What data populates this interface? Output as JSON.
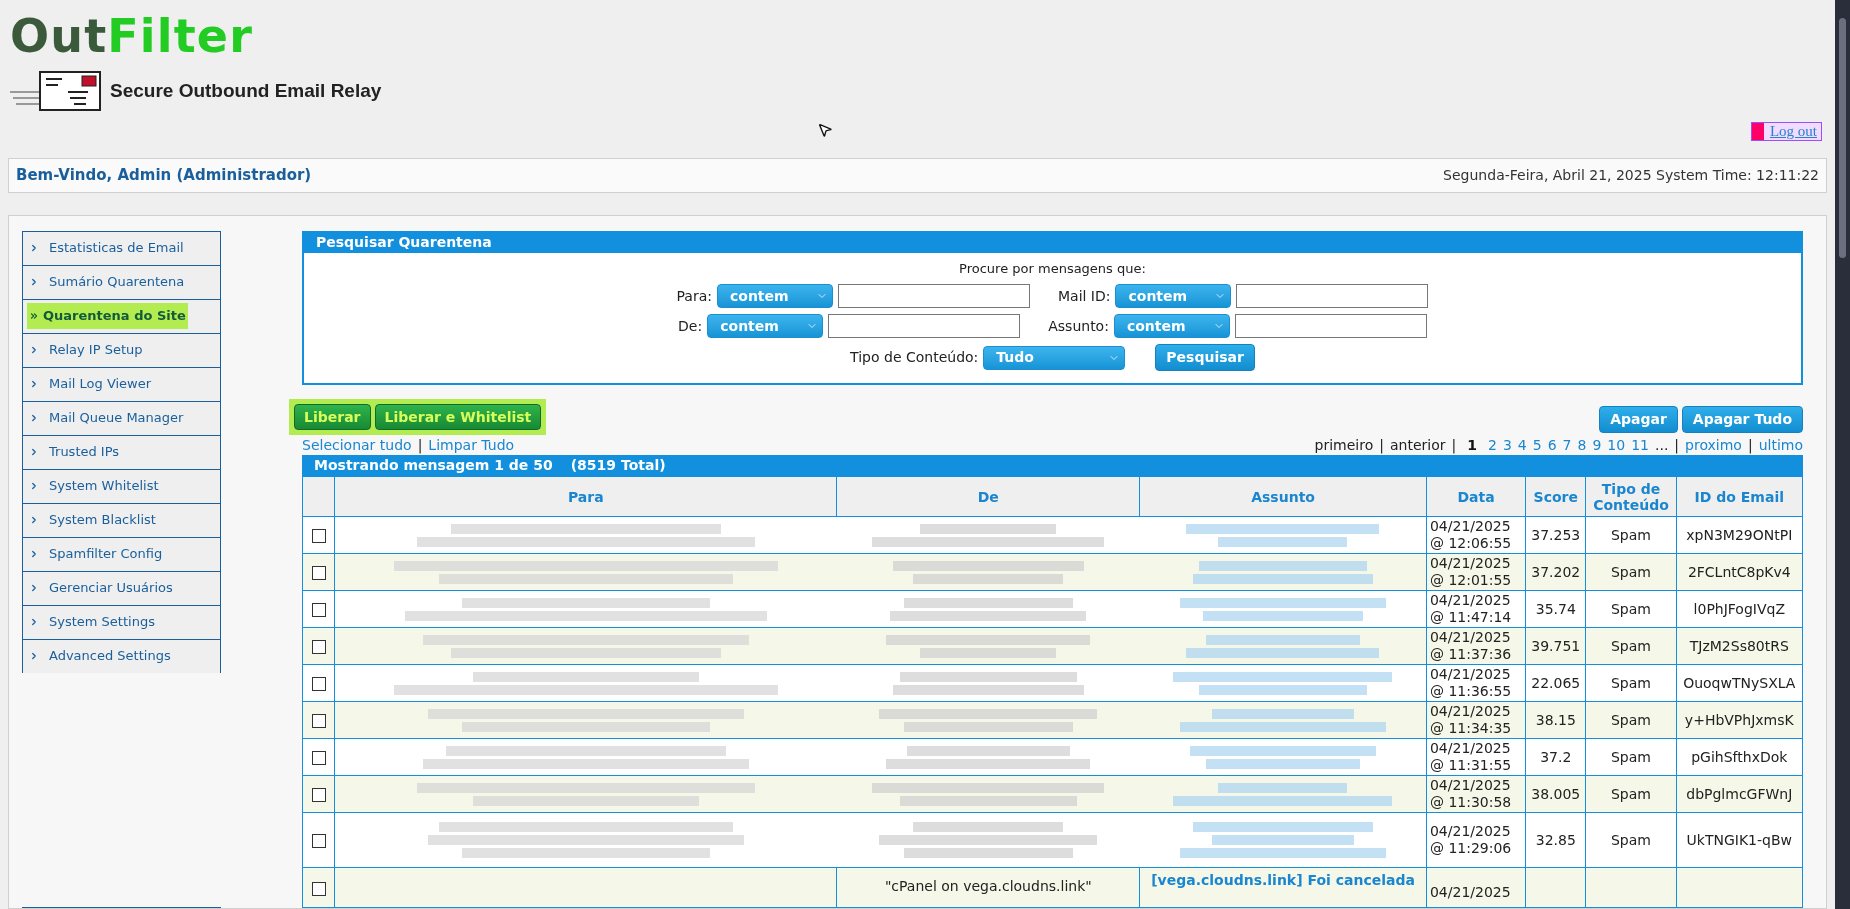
{
  "logo": {
    "word_1": "Out",
    "word_2": "Filter",
    "tagline": "Secure Outbound Email Relay"
  },
  "logout": "Log out",
  "welcome": "Bem-Vindo, Admin (Administrador)",
  "datetime": "Segunda-Feira, Abril 21, 2025 System Time: 12:11:22",
  "sidebar": {
    "items": [
      {
        "label": "Estatisticas de Email",
        "selected": false
      },
      {
        "label": "Sumário Quarentena",
        "selected": false
      },
      {
        "label": "Quarentena do Site",
        "selected": true
      },
      {
        "label": "Relay IP Setup",
        "selected": false
      },
      {
        "label": "Mail Log Viewer",
        "selected": false
      },
      {
        "label": "Mail Queue Manager",
        "selected": false
      },
      {
        "label": "Trusted IPs",
        "selected": false
      },
      {
        "label": "System Whitelist",
        "selected": false
      },
      {
        "label": "System Blacklist",
        "selected": false
      },
      {
        "label": "Spamfilter Config",
        "selected": false
      },
      {
        "label": "Gerenciar Usuários",
        "selected": false
      },
      {
        "label": "System Settings",
        "selected": false
      },
      {
        "label": "Advanced Settings",
        "selected": false
      }
    ]
  },
  "search": {
    "title": "Pesquisar Quarentena",
    "prompt": "Procure por mensagens que:",
    "fields": [
      {
        "label": "Para:",
        "operator": "contem"
      },
      {
        "label": "Mail ID:",
        "operator": "contem"
      },
      {
        "label": "De:",
        "operator": "contem"
      },
      {
        "label": "Assunto:",
        "operator": "contem"
      }
    ],
    "content_type": {
      "label": "Tipo de Conteúdo:",
      "value": "Tudo"
    },
    "button": "Pesquisar"
  },
  "actions_left": [
    "Liberar",
    "Liberar e Whitelist"
  ],
  "actions_right": [
    "Apagar",
    "Apagar Tudo"
  ],
  "selection_links": [
    {
      "label": "Selecionar tudo",
      "kind": "link"
    },
    {
      "label": "|",
      "kind": "separator"
    },
    {
      "label": "Limpar Tudo",
      "kind": "link"
    }
  ],
  "pagination": [
    {
      "label": "primeiro",
      "kind": "text"
    },
    {
      "label": "|",
      "kind": "separator"
    },
    {
      "label": "anterior",
      "kind": "text"
    },
    {
      "label": "|",
      "kind": "separator"
    },
    {
      "label": "1",
      "kind": "page",
      "selected": true
    },
    {
      "label": "2",
      "kind": "page",
      "selected": false
    },
    {
      "label": "3",
      "kind": "page",
      "selected": false
    },
    {
      "label": "4",
      "kind": "page",
      "selected": false
    },
    {
      "label": "5",
      "kind": "page",
      "selected": false
    },
    {
      "label": "6",
      "kind": "page",
      "selected": false
    },
    {
      "label": "7",
      "kind": "page",
      "selected": false
    },
    {
      "label": "8",
      "kind": "page",
      "selected": false
    },
    {
      "label": "9",
      "kind": "page",
      "selected": false
    },
    {
      "label": "10",
      "kind": "page",
      "selected": false
    },
    {
      "label": "11",
      "kind": "page",
      "selected": false
    },
    {
      "label": "...",
      "kind": "text"
    },
    {
      "label": "|",
      "kind": "separator"
    },
    {
      "label": "proximo",
      "kind": "link"
    },
    {
      "label": "|",
      "kind": "separator"
    },
    {
      "label": "ultimo",
      "kind": "link"
    }
  ],
  "table": {
    "title": "Mostrando mensagem 1 de 50",
    "total": "(8519 Total)",
    "columns": [
      "Para",
      "De",
      "Assunto",
      "Data",
      "Score",
      "Tipo de Conteúdo",
      "ID do Email"
    ],
    "rows": [
      {
        "checked": false,
        "date": "04/21/2025",
        "time": "@ 12:06:55",
        "score": "37.253",
        "type": "Spam",
        "id": "xpN3M29ONtPI"
      },
      {
        "checked": false,
        "date": "04/21/2025",
        "time": "@ 12:01:55",
        "score": "37.202",
        "type": "Spam",
        "id": "2FCLntC8pKv4"
      },
      {
        "checked": false,
        "date": "04/21/2025",
        "time": "@ 11:47:14",
        "score": "35.74",
        "type": "Spam",
        "id": "l0PhJFogIVqZ"
      },
      {
        "checked": false,
        "date": "04/21/2025",
        "time": "@ 11:37:36",
        "score": "39.751",
        "type": "Spam",
        "id": "TJzM2Ss80tRS"
      },
      {
        "checked": false,
        "date": "04/21/2025",
        "time": "@ 11:36:55",
        "score": "22.065",
        "type": "Spam",
        "id": "OuoqwTNySXLA"
      },
      {
        "checked": false,
        "date": "04/21/2025",
        "time": "@ 11:34:35",
        "score": "38.15",
        "type": "Spam",
        "id": "y+HbVPhJxmsK"
      },
      {
        "checked": false,
        "date": "04/21/2025",
        "time": "@ 11:31:55",
        "score": "37.2",
        "type": "Spam",
        "id": "pGihSfthxDok"
      },
      {
        "checked": false,
        "date": "04/21/2025",
        "time": "@ 11:30:58",
        "score": "38.005",
        "type": "Spam",
        "id": "dbPglmcGFWnJ"
      },
      {
        "checked": false,
        "date": "04/21/2025",
        "time": "@ 11:29:06",
        "score": "32.85",
        "type": "Spam",
        "id": "UkTNGIK1-qBw"
      }
    ],
    "last_row": {
      "checked": false,
      "from": "\"cPanel on vega.cloudns.link\"",
      "subject": "[vega.cloudns.link] Foi cancelada",
      "date": "04/21/2025"
    }
  }
}
